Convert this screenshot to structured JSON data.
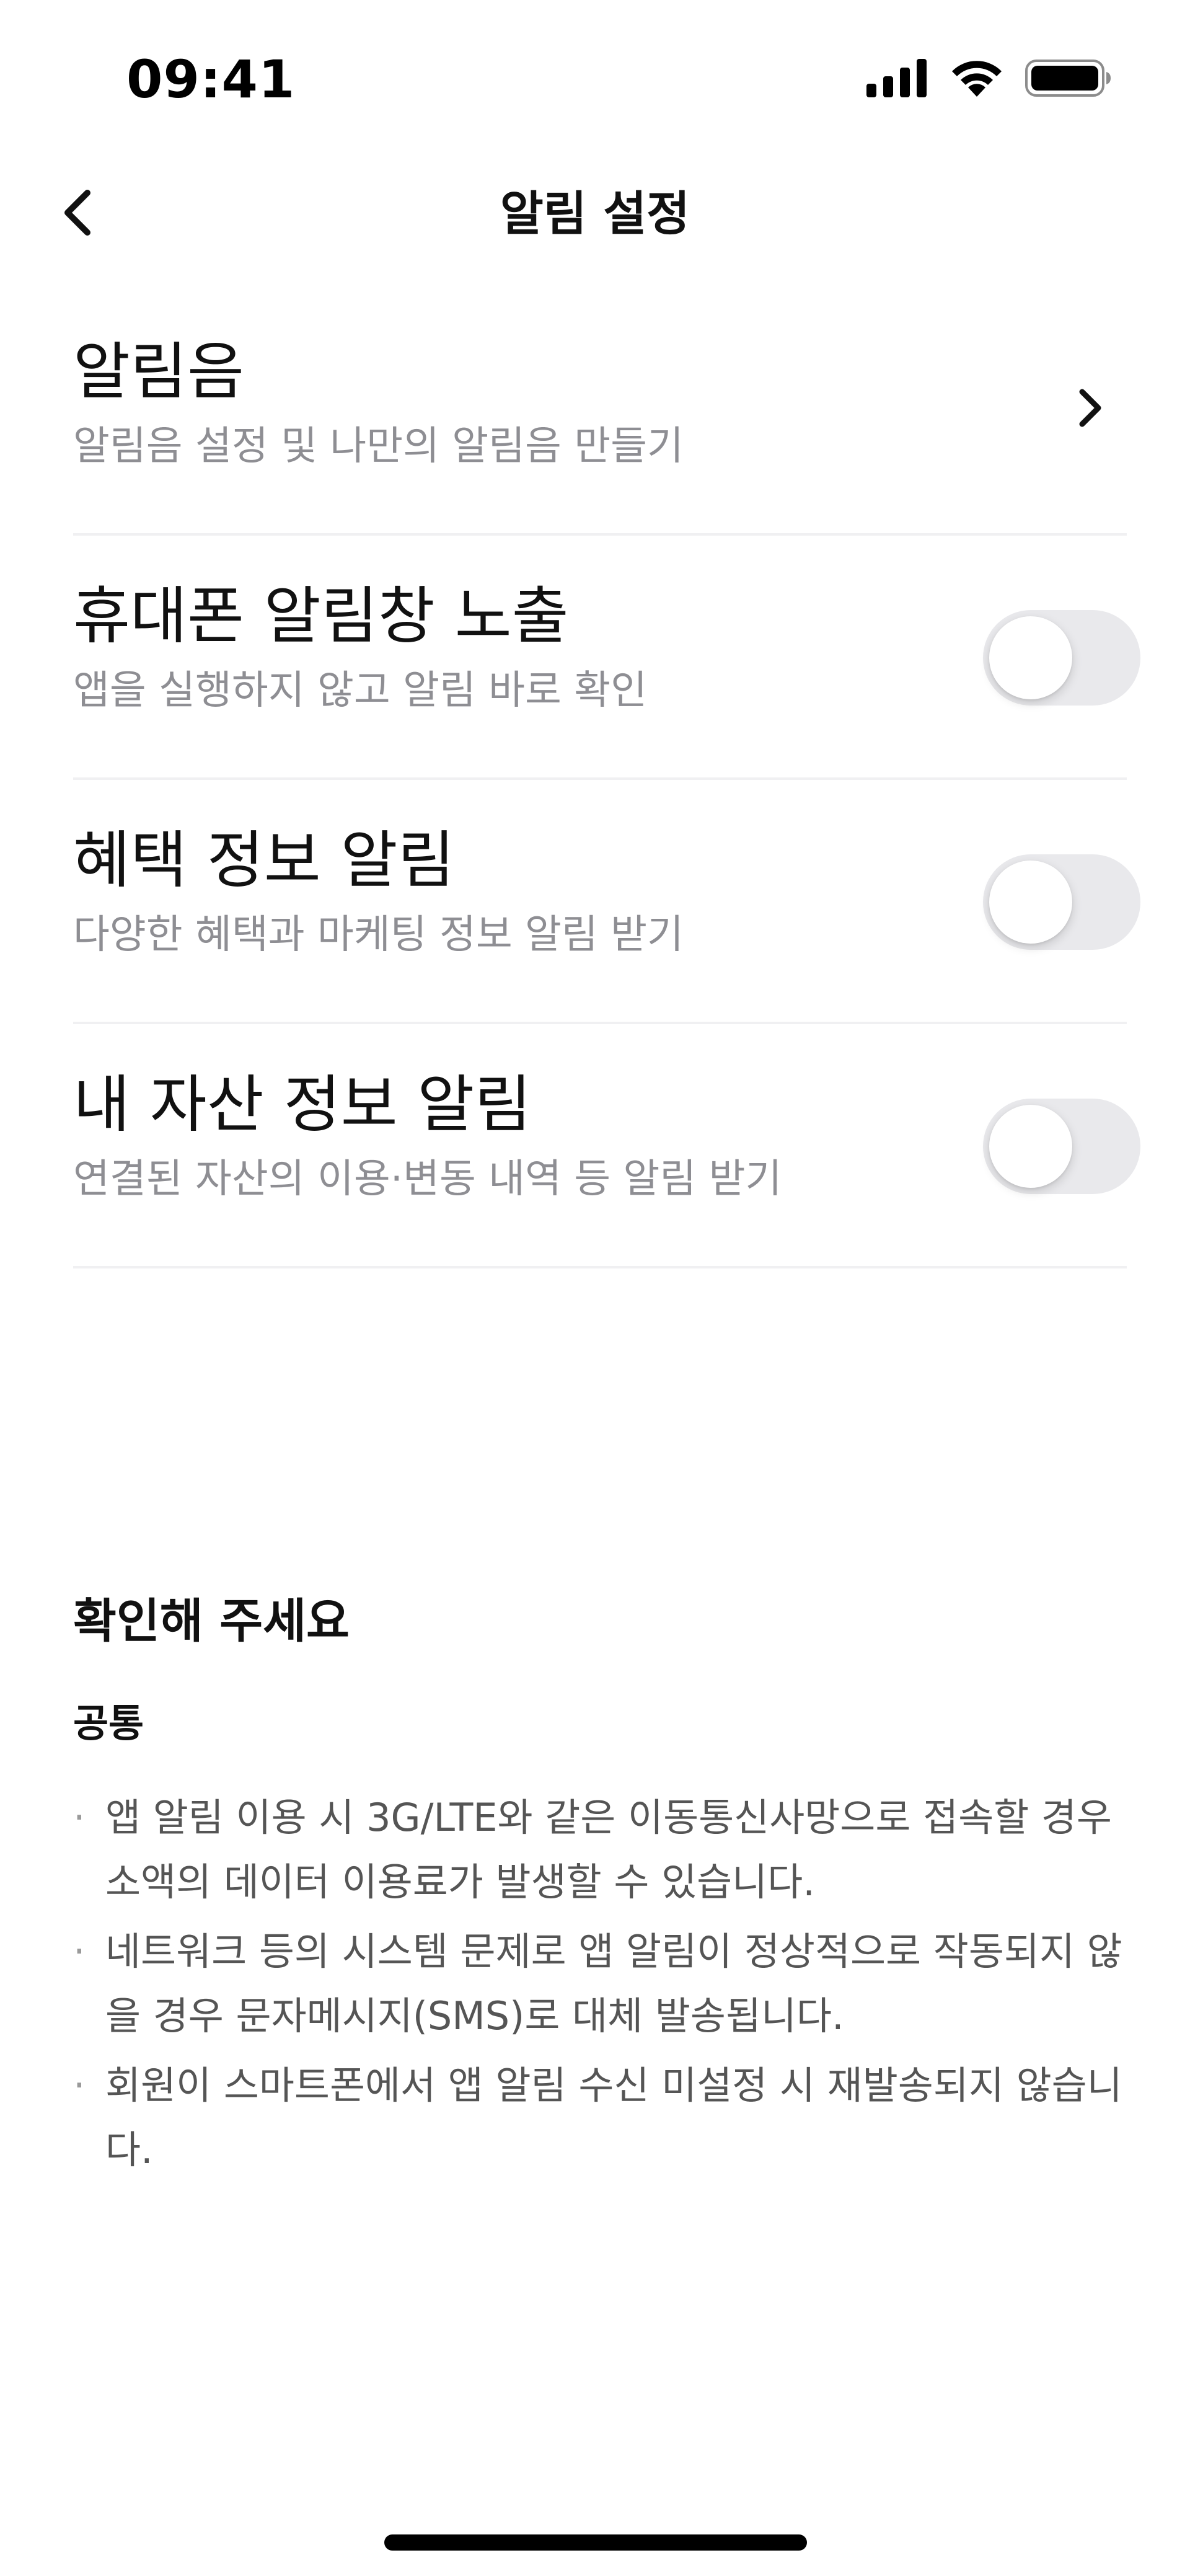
{
  "status_bar": {
    "time": "09:41",
    "icons": [
      "cellular-signal-icon",
      "wifi-icon",
      "battery-icon"
    ]
  },
  "nav": {
    "title": "알림 설정",
    "back_icon": "chevron-left-icon"
  },
  "settings": [
    {
      "title": "알림음",
      "subtitle": "알림음 설정 및 나만의 알림음 만들기",
      "control": "chevron",
      "icon": "chevron-right-icon"
    },
    {
      "title": "휴대폰 알림창 노출",
      "subtitle": "앱을 실행하지 않고 알림 바로 확인",
      "control": "toggle",
      "on": false
    },
    {
      "title": "혜택 정보 알림",
      "subtitle": "다양한 혜택과 마케팅 정보 알림 받기",
      "control": "toggle",
      "on": false
    },
    {
      "title": "내 자산 정보 알림",
      "subtitle": "연결된 자산의 이용·변동 내역 등 알림 받기",
      "control": "toggle",
      "on": false
    }
  ],
  "notice": {
    "title": "확인해 주세요",
    "subtitle": "공통",
    "bullet": "·",
    "items": [
      "앱 알림 이용 시 3G/LTE와 같은 이동통신사망으로 접속할 경우 소액의 데이터 이용료가 발생할 수 있습니다.",
      "네트워크 등의 시스템 문제로 앱 알림이 정상적으로 작동되지 않을 경우 문자메시지(SMS)로 대체 발송됩니다.",
      "회원이 스마트폰에서 앱 알림 수신 미설정 시 재발송되지 않습니다."
    ]
  },
  "colors": {
    "background": "#ffffff",
    "text_primary": "#111111",
    "text_secondary": "#8e8e93",
    "toggle_off_track": "#e9e9ec",
    "divider": "#f0f0f2"
  }
}
